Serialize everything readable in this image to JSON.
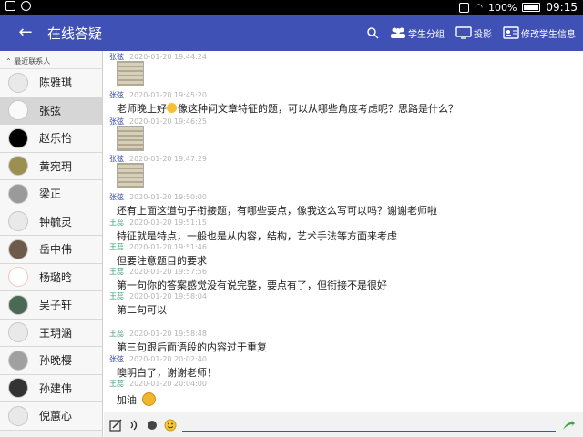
{
  "status": {
    "battery": "100%",
    "time": "09:15"
  },
  "header": {
    "title": "在线答疑",
    "actions": {
      "group": "学生分组",
      "project": "投影",
      "edit": "修改学生信息"
    }
  },
  "sidebar": {
    "section_label": "最近联系人",
    "contacts": [
      {
        "name": "陈雅琪"
      },
      {
        "name": "张弦"
      },
      {
        "name": "赵乐怡"
      },
      {
        "name": "黄宛玥"
      },
      {
        "name": "梁正"
      },
      {
        "name": "钟毓灵"
      },
      {
        "name": "岳中伟"
      },
      {
        "name": "杨璐晗"
      },
      {
        "name": "吴子轩"
      },
      {
        "name": "王玥涵"
      },
      {
        "name": "孙晚樱"
      },
      {
        "name": "孙建伟"
      },
      {
        "name": "倪蕙心"
      }
    ]
  },
  "messages": [
    {
      "sender": "张弦",
      "time": "2020-01-20 19:44:24",
      "text": ""
    },
    {
      "sender": "张弦",
      "time": "2020-01-20 19:45:20",
      "text": "老师晚上好",
      "text2": "像这种问文章特征的题，可以从哪些角度考虑呢？思路是什么？"
    },
    {
      "sender": "张弦",
      "time": "2020-01-20 19:46:25",
      "text": ""
    },
    {
      "sender": "张弦",
      "time": "2020-01-20 19:47:29",
      "text": ""
    },
    {
      "sender": "张弦",
      "time": "2020-01-20 19:50:00",
      "text": "还有上面这道句子衔接题，有哪些要点，像我这么写可以吗？谢谢老师啦"
    },
    {
      "sender": "王蕊",
      "time": "2020-01-20 19:51:15",
      "text": "特征就是特点，一般也是从内容，结构，艺术手法等方面来考虑"
    },
    {
      "sender": "王蕊",
      "time": "2020-01-20 19:51:46",
      "text": "但要注意题目的要求"
    },
    {
      "sender": "王蕊",
      "time": "2020-01-20 19:57:56",
      "text": "第一句你的答案感觉没有说完整，要点有了，但衔接不是很好"
    },
    {
      "sender": "王蕊",
      "time": "2020-01-20 19:58:04",
      "text": "第二句可以"
    },
    {
      "sender": "王蕊",
      "time": "2020-01-20 19:58:48",
      "text": "第三句跟后面语段的内容过于重复"
    },
    {
      "sender": "张弦",
      "time": "2020-01-20 20:02:40",
      "text": "噢明白了，谢谢老师！"
    },
    {
      "sender": "王蕊",
      "time": "2020-01-20 20:04:00",
      "text": "加油"
    }
  ]
}
